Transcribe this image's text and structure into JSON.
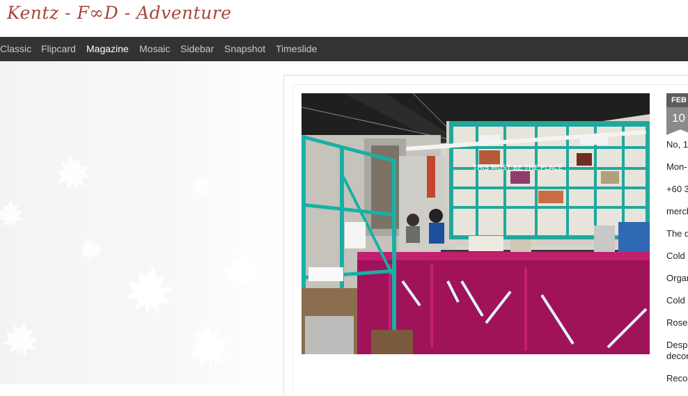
{
  "site": {
    "title": "Kentz - F∞D - Adventure"
  },
  "nav": {
    "items": [
      {
        "label": "Classic"
      },
      {
        "label": "Flipcard"
      },
      {
        "label": "Magazine"
      },
      {
        "label": "Mosaic"
      },
      {
        "label": "Sidebar"
      },
      {
        "label": "Snapshot"
      },
      {
        "label": "Timeslide"
      }
    ],
    "active": "Magazine"
  },
  "post": {
    "date_month": "FEB",
    "date_day": "10",
    "photo_sign": "THIS MUST BE THE PLACE",
    "lines": [
      "No, 1",
      "Mon-",
      "+60 3",
      "merch",
      "The d",
      "Cold",
      "Organ",
      "Cold",
      "Rose",
      "Despi",
      "decor",
      "Recor"
    ]
  },
  "colors": {
    "title": "#a5473b",
    "nav_bg": "#333333",
    "nav_text": "#c9c9c9",
    "nav_active": "#ffffff",
    "badge_month": "#5c5c5c",
    "badge_day": "#8a8a8a"
  }
}
